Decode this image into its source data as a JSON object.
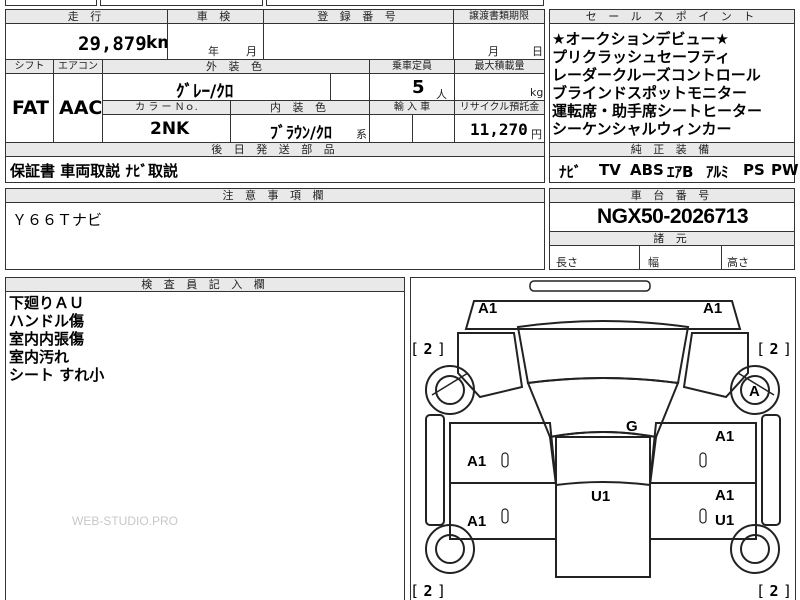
{
  "header": {
    "mileage_label": "走 行",
    "mileage_value": "29,879",
    "mileage_unit": "km",
    "shaken_label": "車 検",
    "shaken_year_unit": "年",
    "shaken_month_unit": "月",
    "registration_label": "登 録 番 号",
    "transfer_label": "譲渡書類期限",
    "transfer_month_unit": "月",
    "transfer_day_unit": "日"
  },
  "specs": {
    "shift_label": "シフト",
    "shift_value": "FAT",
    "aircon_label": "エアコン",
    "aircon_value": "AAC",
    "exterior_label": "外 装 色",
    "exterior_value": "ｸﾞﾚｰ/ｸﾛ",
    "color_no_label": "カ ラ ー Ｎｏ.",
    "color_no_value": "2NK",
    "interior_label": "内 装 色",
    "interior_value": "ﾌﾞﾗｳﾝ/ｸﾛ",
    "interior_suffix": "系",
    "capacity_label": "乗車定員",
    "capacity_value": "5",
    "capacity_unit": "人",
    "load_label": "最大積載量",
    "load_unit": "kg",
    "import_label": "輸 入 車",
    "recycle_label": "リサイクル預託金",
    "recycle_value": "11,270",
    "recycle_unit": "円"
  },
  "parts": {
    "label": "後 日 発 送 部 品",
    "value": "保証書 車両取説 ﾅﾋﾞ取説"
  },
  "sales_points": {
    "label": "セ ー ル ス ポ イ ン ト",
    "lines": [
      "★オークションデビュー★",
      "プリクラッシュセーフティ",
      "レーダークルーズコントロール",
      "ブラインドスポットモニター",
      "運転席・助手席シートヒーター",
      "シーケンシャルウィンカー"
    ]
  },
  "genuine_equipment": {
    "label": "純 正 装 備",
    "items": [
      "ﾅﾋﾞ",
      "TV",
      "ABS",
      "ｴｱB",
      "ｱﾙﾐ",
      "PS",
      "PW"
    ]
  },
  "notes": {
    "label": "注 意 事 項 欄",
    "value": "Ｙ６６Ｔナビ"
  },
  "chassis": {
    "label": "車 台 番 号",
    "value": "NGX50-2026713"
  },
  "dimensions": {
    "label": "諸 元",
    "length_label": "長さ",
    "width_label": "幅",
    "height_label": "高さ"
  },
  "inspector": {
    "label": "検 査 員 記 入 欄",
    "lines": [
      "下廻りＡＵ",
      "ハンドル傷",
      "室内内張傷",
      "室内汚れ",
      "シート すれ小"
    ]
  },
  "watermark": "WEB-STUDIO.PRO",
  "diagram": {
    "marks": {
      "front_left": "A1",
      "front_right": "A1",
      "front_right_wheel": "A",
      "roof": "G",
      "right_front_door": "A1",
      "left_front_door": "A1",
      "floor": "U1",
      "right_rear_door_1": "A1",
      "right_rear_door_2": "U1",
      "left_rear_door": "A1"
    },
    "brackets": {
      "upper_left": "2",
      "upper_right": "2",
      "lower_left": "2",
      "lower_right": "2"
    }
  }
}
